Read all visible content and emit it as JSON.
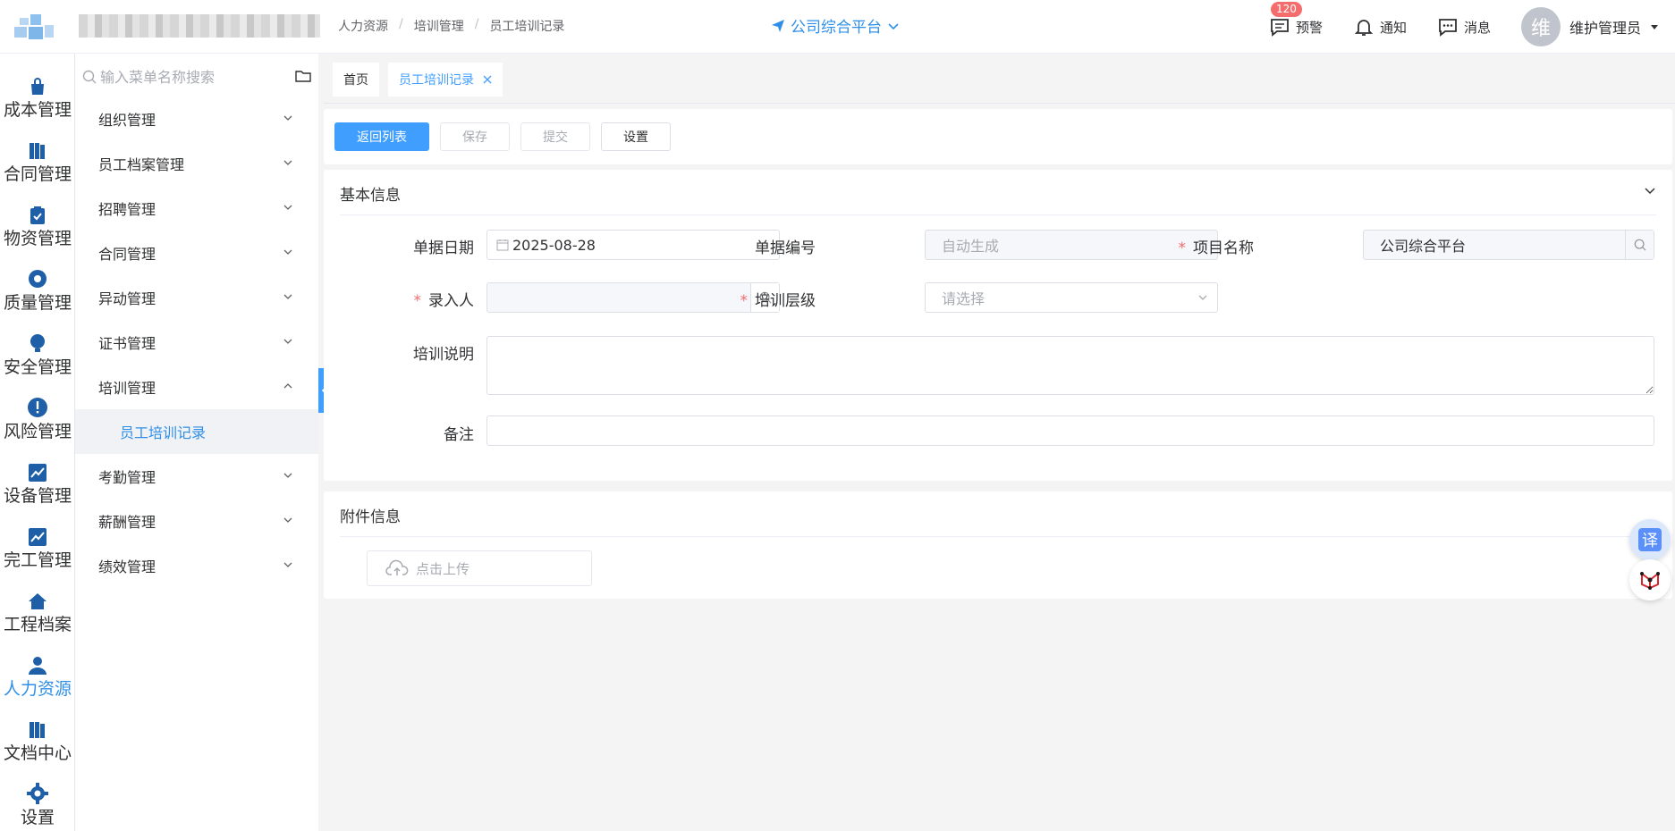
{
  "header": {
    "breadcrumb": [
      "人力资源",
      "培训管理",
      "员工培训记录"
    ],
    "platform": "公司综合平台",
    "alerts_label": "预警",
    "alerts_count": "120",
    "notify_label": "通知",
    "message_label": "消息",
    "avatar_char": "维",
    "user_name": "维护管理员"
  },
  "rail": [
    "成本管理",
    "合同管理",
    "物资管理",
    "质量管理",
    "安全管理",
    "风险管理",
    "设备管理",
    "完工管理",
    "工程档案",
    "人力资源",
    "文档中心",
    "设置"
  ],
  "menu": {
    "search_placeholder": "输入菜单名称搜索",
    "items": [
      "组织管理",
      "员工档案管理",
      "招聘管理",
      "合同管理",
      "异动管理",
      "证书管理",
      "培训管理"
    ],
    "sub_item": "员工培训记录",
    "items_after": [
      "考勤管理",
      "薪酬管理",
      "绩效管理"
    ]
  },
  "tabs": {
    "home": "首页",
    "current": "员工培训记录"
  },
  "toolbar": {
    "back": "返回列表",
    "save": "保存",
    "submit": "提交",
    "settings": "设置"
  },
  "basic": {
    "title": "基本信息",
    "date_label": "单据日期",
    "date_value": "2025-08-28",
    "code_label": "单据编号",
    "code_placeholder": "自动生成",
    "project_label": "项目名称",
    "project_value": "公司综合平台",
    "entry_label": "录入人",
    "level_label": "培训层级",
    "level_placeholder": "请选择",
    "desc_label": "培训说明",
    "note_label": "备注"
  },
  "attach": {
    "title": "附件信息",
    "upload": "点击上传"
  },
  "floating": {
    "translate": "译"
  },
  "colors": {
    "accent": "#409eff",
    "brand": "#2f8fe8",
    "required": "#f56c6c"
  }
}
